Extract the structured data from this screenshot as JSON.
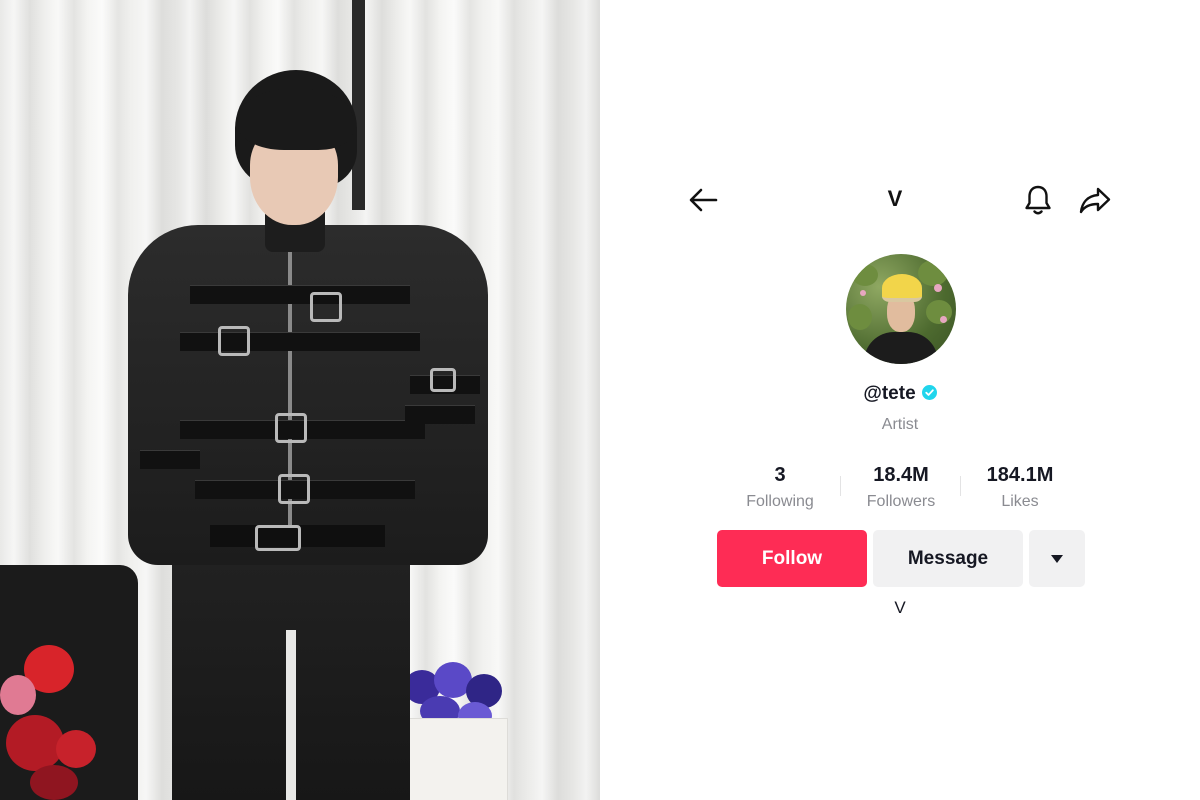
{
  "header": {
    "title": "V",
    "back_icon": "back-arrow-icon",
    "bell_icon": "bell-icon",
    "share_icon": "share-icon"
  },
  "profile": {
    "username": "@tete",
    "verified": true,
    "role": "Artist",
    "bio": "V"
  },
  "stats": {
    "following": {
      "value": "3",
      "label": "Following"
    },
    "followers": {
      "value": "18.4M",
      "label": "Followers"
    },
    "likes": {
      "value": "184.1M",
      "label": "Likes"
    }
  },
  "actions": {
    "follow_label": "Follow",
    "message_label": "Message",
    "more_icon": "caret-down-icon"
  },
  "colors": {
    "follow_button": "#fe2c55",
    "secondary_button": "#f1f1f2",
    "verified_badge": "#20d5ec",
    "muted_text": "#8a8b91"
  }
}
